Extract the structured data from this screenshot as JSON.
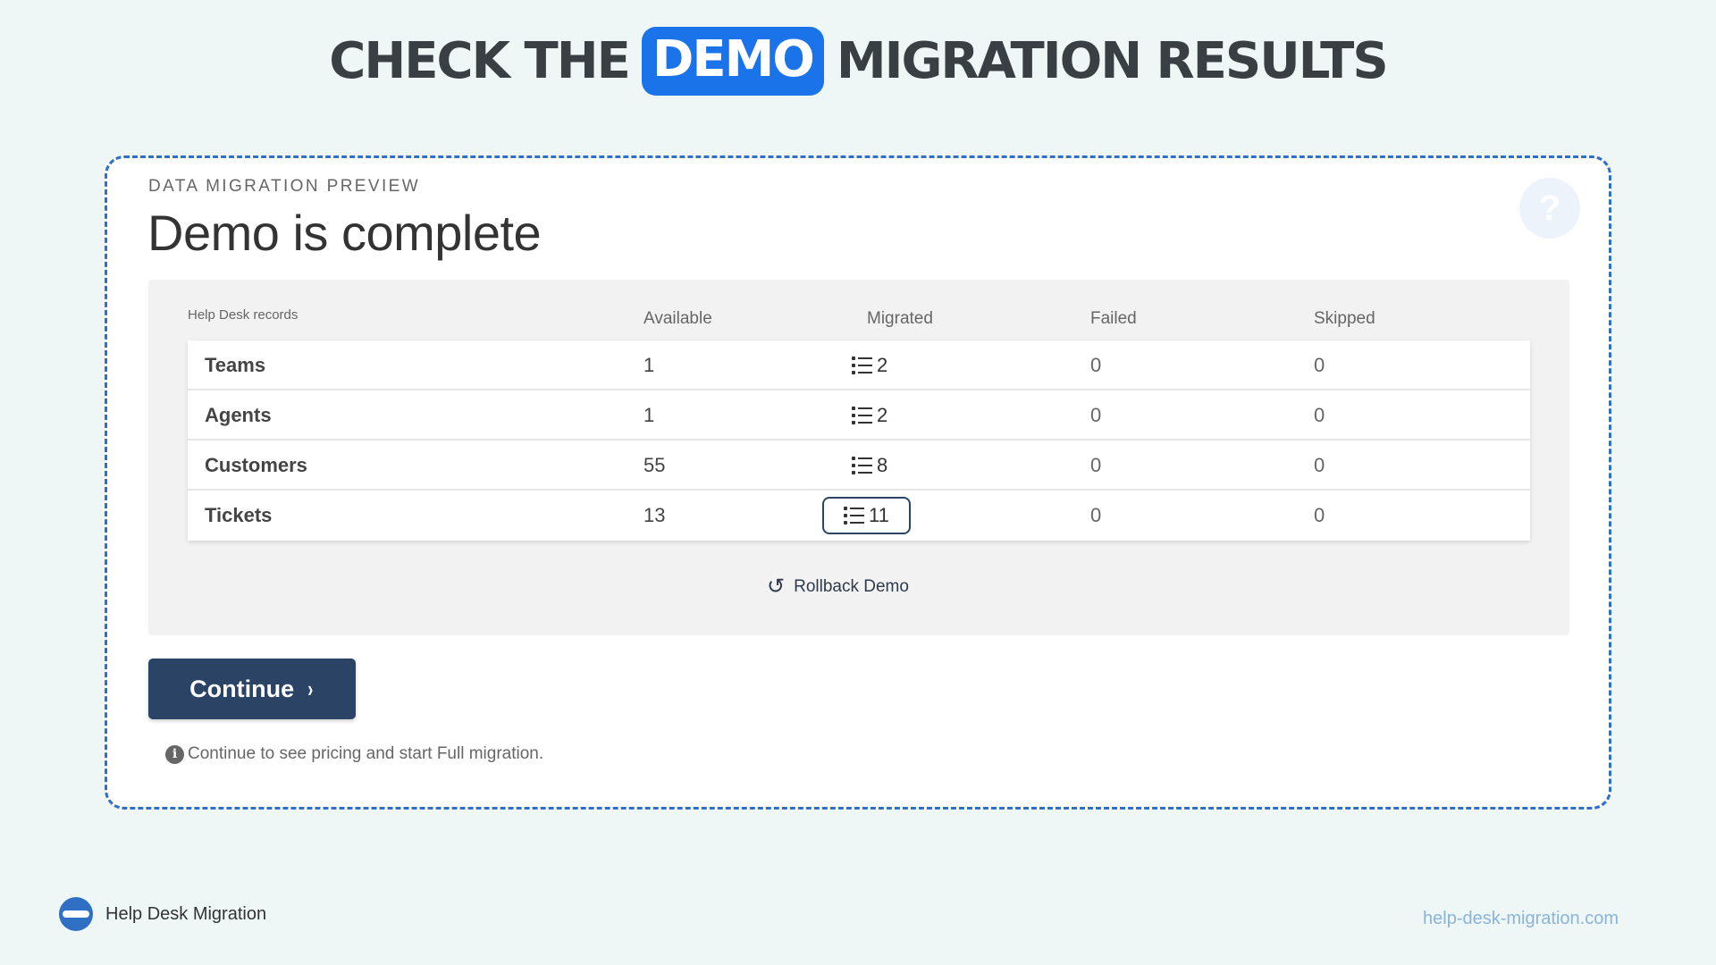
{
  "headline": {
    "before": "CHECK THE",
    "highlight": "DEMO",
    "after": "MIGRATION RESULTS"
  },
  "card": {
    "eyebrow": "DATA MIGRATION PREVIEW",
    "title": "Demo is complete",
    "help_icon": "question-icon",
    "help_glyph": "?"
  },
  "table": {
    "headers": {
      "records": "Help Desk records",
      "available": "Available",
      "migrated": "Migrated",
      "failed": "Failed",
      "skipped": "Skipped"
    },
    "rows": [
      {
        "name": "Teams",
        "available": "1",
        "migrated": "2",
        "failed": "0",
        "skipped": "0"
      },
      {
        "name": "Agents",
        "available": "1",
        "migrated": "2",
        "failed": "0",
        "skipped": "0"
      },
      {
        "name": "Customers",
        "available": "55",
        "migrated": "8",
        "failed": "0",
        "skipped": "0"
      },
      {
        "name": "Tickets",
        "available": "13",
        "migrated": "11",
        "failed": "0",
        "skipped": "0"
      }
    ]
  },
  "rollback": {
    "label": "Rollback Demo",
    "icon": "undo-icon",
    "glyph": "↺"
  },
  "continue": {
    "label": "Continue",
    "icon": "chevron-right-icon",
    "glyph": "›"
  },
  "note": {
    "icon": "info-icon",
    "glyph": "i",
    "text": "Continue to see pricing and start Full migration."
  },
  "footer": {
    "brand": "Help Desk Migration",
    "site": "help-desk-migration.com"
  },
  "colors": {
    "accent": "#1a73e8",
    "button": "#2b4466",
    "frame": "#2f6fc4",
    "background": "#eef6f6"
  }
}
